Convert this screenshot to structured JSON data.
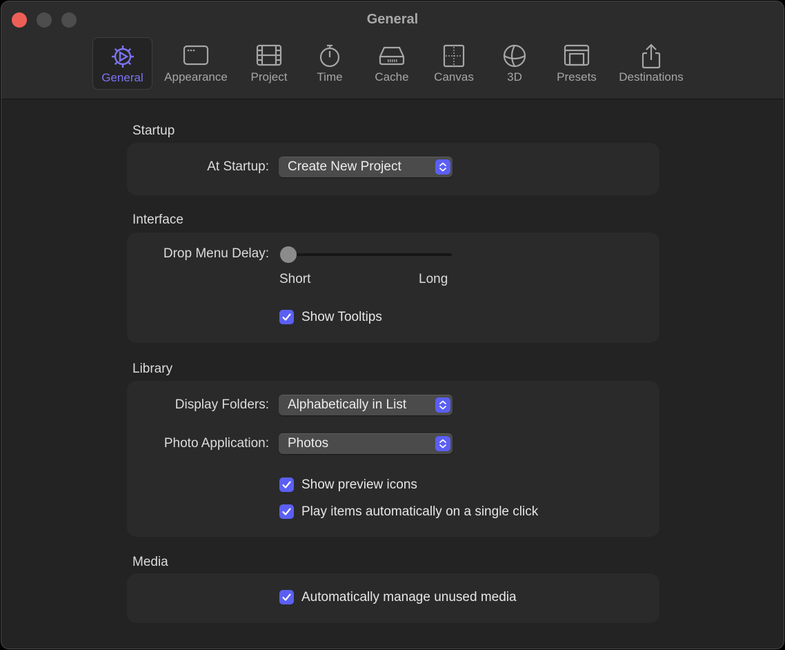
{
  "window": {
    "title": "General"
  },
  "toolbar": {
    "tabs": [
      {
        "label": "General",
        "icon": "gear-icon",
        "active": true
      },
      {
        "label": "Appearance",
        "icon": "window-icon"
      },
      {
        "label": "Project",
        "icon": "film-strip-icon"
      },
      {
        "label": "Time",
        "icon": "stopwatch-icon"
      },
      {
        "label": "Cache",
        "icon": "drive-icon"
      },
      {
        "label": "Canvas",
        "icon": "canvas-grid-icon"
      },
      {
        "label": "3D",
        "icon": "sphere-icon"
      },
      {
        "label": "Presets",
        "icon": "presets-layout-icon"
      },
      {
        "label": "Destinations",
        "icon": "share-icon"
      }
    ]
  },
  "startup": {
    "title": "Startup",
    "at_startup_label": "At Startup:",
    "at_startup_value": "Create New Project"
  },
  "interface": {
    "title": "Interface",
    "drop_menu_delay_label": "Drop Menu Delay:",
    "slider_min_label": "Short",
    "slider_max_label": "Long",
    "drop_menu_delay_value": 0,
    "show_tooltips_label": "Show Tooltips",
    "show_tooltips_checked": true
  },
  "library": {
    "title": "Library",
    "display_folders_label": "Display Folders:",
    "display_folders_value": "Alphabetically in List",
    "photo_app_label": "Photo Application:",
    "photo_app_value": "Photos",
    "show_preview_icons_label": "Show preview icons",
    "show_preview_icons_checked": true,
    "play_items_label": "Play items automatically on a single click",
    "play_items_checked": true
  },
  "media": {
    "title": "Media",
    "auto_manage_label": "Automatically manage unused media",
    "auto_manage_checked": true
  },
  "colors": {
    "accent": "#5b5ff3",
    "active_tab": "#7d74f2",
    "close_button": "#ec5f57"
  }
}
